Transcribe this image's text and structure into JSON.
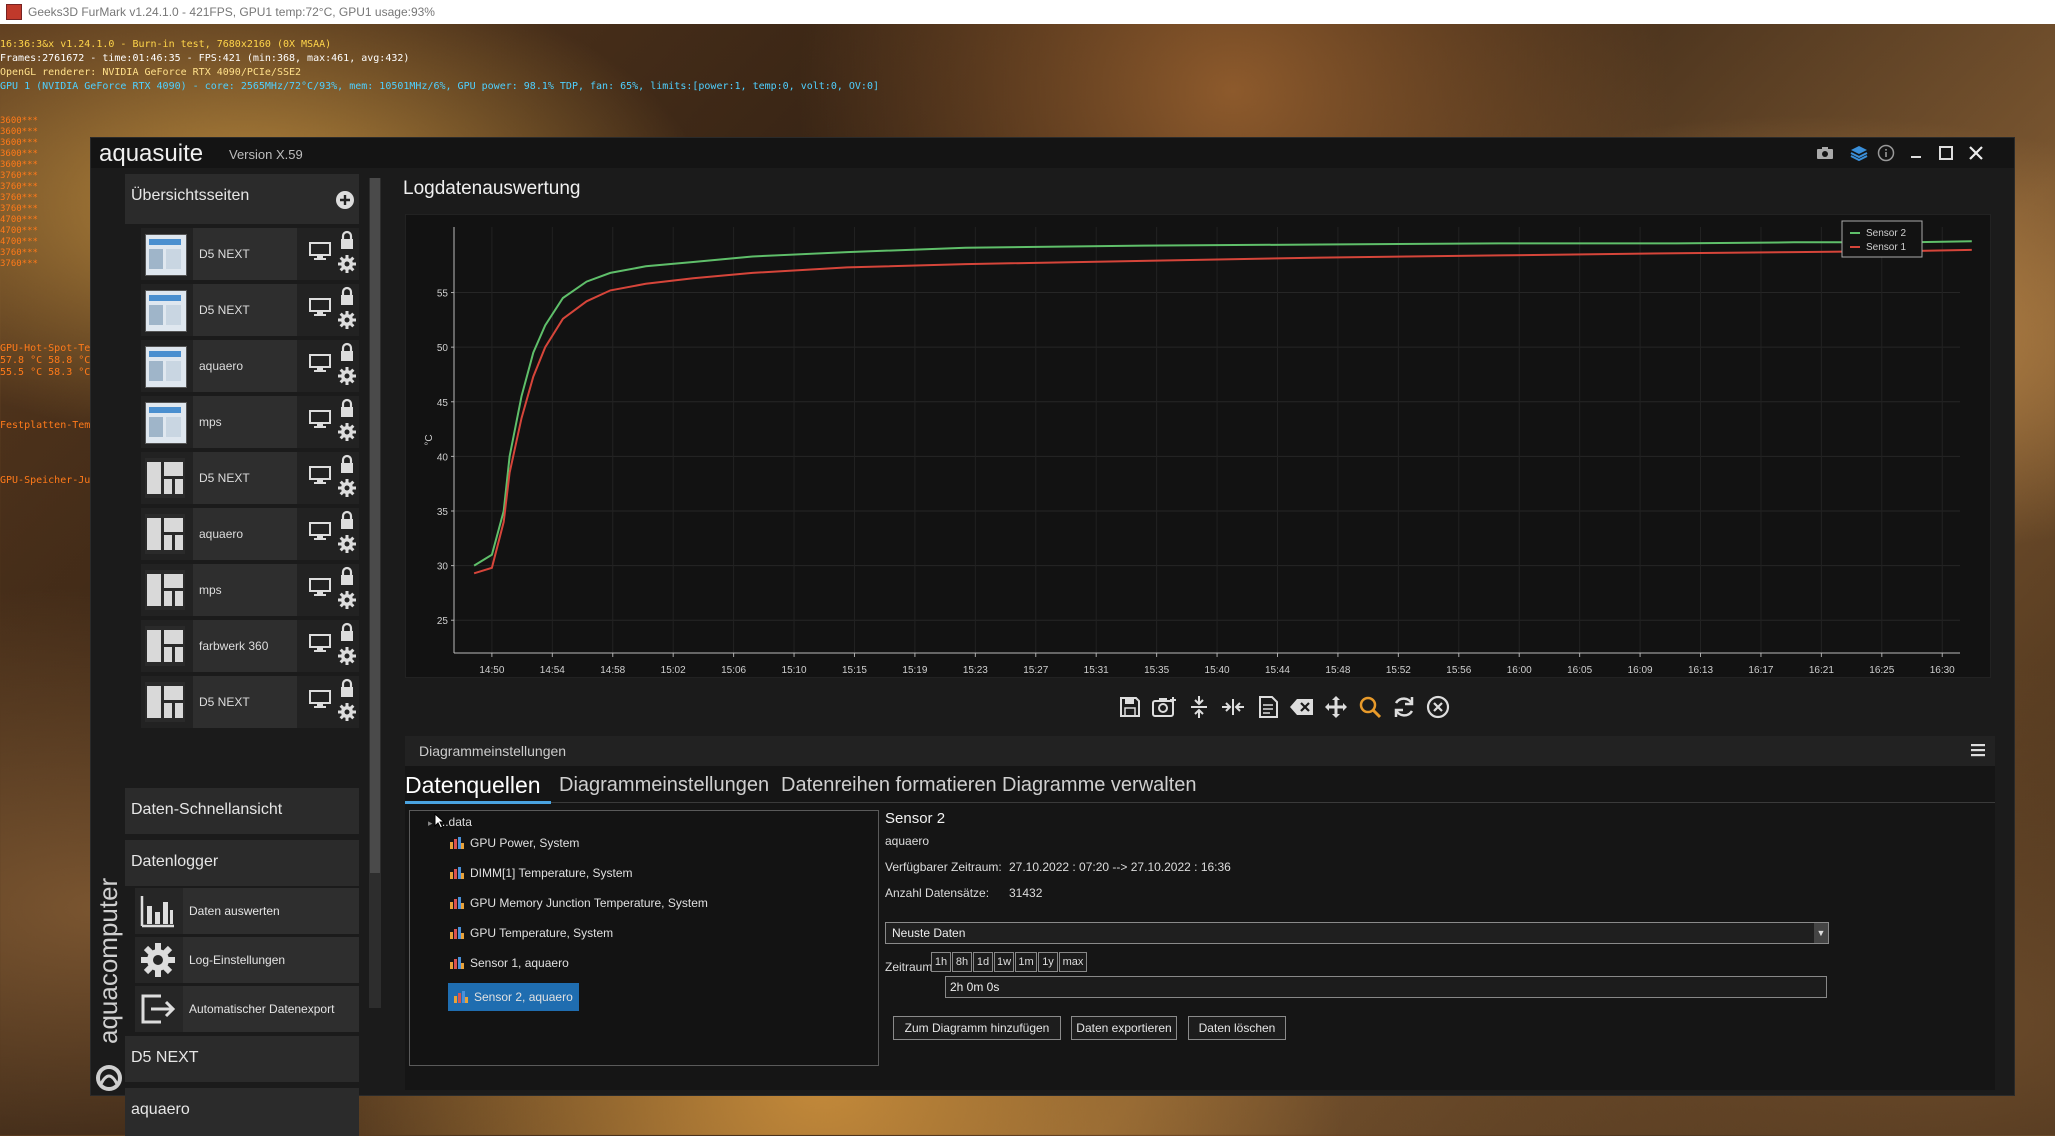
{
  "host": {
    "title": "Geeks3D FurMark v1.24.1.0 - 421FPS, GPU1 temp:72°C, GPU1 usage:93%"
  },
  "overlay": {
    "line1": "16:36:3&x v1.24.1.0 - Burn-in test, 7680x2160 (0X MSAA)",
    "line2": "Frames:2761672 - time:01:46:35 - FPS:421 (min:368, max:461, avg:432)",
    "line3": "OpenGL renderer: NVIDIA GeForce RTX 4090/PCIe/SSE2",
    "line4": "GPU 1 (NVIDIA GeForce RTX 4090) - core: 2565MHz/72°C/93%, mem: 10501MHz/6%, GPU power: 98.1% TDP, fan: 65%, limits:[power:1, temp:0, volt:0, OV:0]",
    "side_values": [
      "3600***",
      "3600***",
      "3600***",
      "3600***",
      "3600***",
      "3760***",
      "3760***",
      "3760***",
      "3760***",
      "4700***",
      "4700***",
      "4700***",
      "3760***",
      "3760***"
    ],
    "gpu_hot_spot": "GPU-Hot-Spot-Te",
    "gpu_hot_values1": "57.8 °C 58.8 °C",
    "gpu_hot_values2": "55.5 °C 58.3 °C",
    "disk_temp": "Festplatten-Tem",
    "gpu_mem": "GPU-Speicher-Ju"
  },
  "app": {
    "name": "aquasuite",
    "version": "Version X.59",
    "brand": "aquacomputer"
  },
  "sidebar": {
    "overview_header": "Übersichtsseiten",
    "pages": [
      {
        "label": "D5 NEXT",
        "thumb": "screen"
      },
      {
        "label": "D5 NEXT",
        "thumb": "screen"
      },
      {
        "label": "aquaero",
        "thumb": "screen"
      },
      {
        "label": "mps",
        "thumb": "screen"
      },
      {
        "label": "D5 NEXT",
        "thumb": "grid"
      },
      {
        "label": "aquaero",
        "thumb": "grid"
      },
      {
        "label": "mps",
        "thumb": "grid"
      },
      {
        "label": "farbwerk 360",
        "thumb": "grid"
      },
      {
        "label": "D5 NEXT",
        "thumb": "grid"
      }
    ],
    "quickview_header": "Daten-Schnellansicht",
    "datalogger_header": "Datenlogger",
    "datalogger_tools": [
      {
        "label": "Daten auswerten",
        "icon": "bar-chart-icon"
      },
      {
        "label": "Log-Einstellungen",
        "icon": "gear-icon"
      },
      {
        "label": "Automatischer Datenexport",
        "icon": "export-icon"
      }
    ],
    "d5_header": "D5 NEXT",
    "aquaero_header": "aquaero"
  },
  "content": {
    "title": "Logdatenauswertung"
  },
  "chart_data": {
    "type": "line",
    "title": "",
    "xlabel": "",
    "ylabel": "°C",
    "ylim": [
      22,
      61
    ],
    "yticks": [
      25,
      30,
      35,
      40,
      45,
      50,
      55
    ],
    "x_tick_labels": [
      "14:50",
      "14:54",
      "14:58",
      "15:02",
      "15:06",
      "15:10",
      "15:15",
      "15:19",
      "15:23",
      "15:27",
      "15:31",
      "15:35",
      "15:40",
      "15:44",
      "15:48",
      "15:52",
      "15:56",
      "16:00",
      "16:05",
      "16:09",
      "16:13",
      "16:17",
      "16:21",
      "16:25",
      "16:30"
    ],
    "legend_position": "top-right",
    "series": [
      {
        "name": "Sensor 2",
        "color": "#5fbf6a",
        "x_min": [
          -1.5,
          0,
          1,
          1.5,
          2.5,
          3.5,
          4.5,
          6,
          8,
          10,
          13,
          17,
          22,
          30,
          40,
          55,
          70,
          85,
          100,
          110,
          120,
          125
        ],
        "values": [
          30,
          31,
          35,
          40,
          45.5,
          49.5,
          52,
          54.5,
          56,
          56.8,
          57.4,
          57.8,
          58.3,
          58.7,
          59.1,
          59.3,
          59.4,
          59.5,
          59.5,
          59.6,
          59.6,
          59.7
        ]
      },
      {
        "name": "Sensor 1",
        "color": "#d6453a",
        "x_min": [
          -1.5,
          0,
          1,
          1.5,
          2.5,
          3.5,
          4.5,
          6,
          8,
          10,
          13,
          17,
          22,
          30,
          40,
          55,
          70,
          85,
          100,
          110,
          120,
          125
        ],
        "values": [
          29.3,
          29.8,
          34,
          38.5,
          43.5,
          47.3,
          50,
          52.6,
          54.2,
          55.2,
          55.8,
          56.3,
          56.8,
          57.3,
          57.6,
          57.9,
          58.2,
          58.4,
          58.6,
          58.7,
          58.8,
          58.9
        ]
      }
    ]
  },
  "toolbar": {
    "icons": [
      "save-icon",
      "camera-icon",
      "compress-vertical-icon",
      "compress-horizontal-icon",
      "report-icon",
      "clear-icon",
      "move-icon",
      "zoom-icon",
      "refresh-icon",
      "close-circle-icon"
    ]
  },
  "settings": {
    "header": "Diagrammeinstellungen",
    "tabs": [
      "Datenquellen",
      "Diagrammeinstellungen",
      "Datenreihen formatieren",
      "Diagramme verwalten"
    ],
    "tree_root": "...data",
    "tree_items": [
      "GPU Power, System",
      "DIMM[1] Temperature, System",
      "GPU Memory Junction Temperature, System",
      "GPU Temperature, System",
      "Sensor 1, aquaero",
      "Sensor 2, aquaero"
    ],
    "selected_index": 5,
    "detail": {
      "title": "Sensor 2",
      "device": "aquaero",
      "range_label": "Verfügbarer Zeitraum:",
      "range_value": "27.10.2022 : 07:20 --> 27.10.2022 : 16:36",
      "count_label": "Anzahl Datensätze:",
      "count_value": "31432",
      "dropdown_value": "Neuste Daten",
      "zeitraum_label": "Zeitraum",
      "range_buttons": [
        "1h",
        "8h",
        "1d",
        "1w",
        "1m",
        "1y",
        "max"
      ],
      "zeitraum_value": "2h 0m 0s",
      "buttons": [
        "Zum Diagramm hinzufügen",
        "Daten exportieren",
        "Daten löschen"
      ]
    }
  }
}
